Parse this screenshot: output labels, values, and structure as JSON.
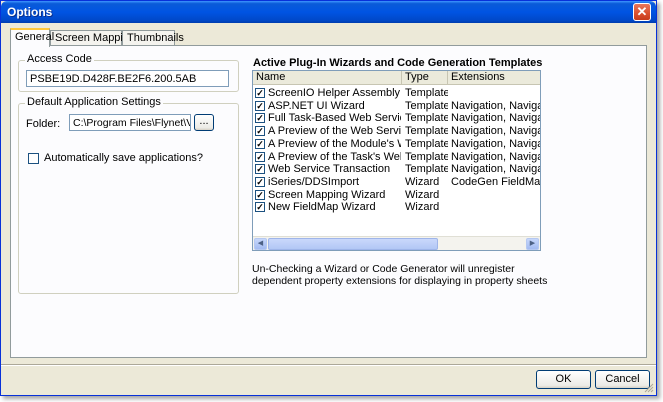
{
  "window": {
    "title": "Options",
    "close_glyph": "✕"
  },
  "tabs": [
    {
      "label": "General"
    },
    {
      "label": "Screen Mapping"
    },
    {
      "label": "Thumbnails"
    }
  ],
  "access_code": {
    "legend": "Access Code",
    "value": "PSBE19D.D428F.BE2F6.200.5AB"
  },
  "app_settings": {
    "legend": "Default Application Settings",
    "folder_label": "Folder:",
    "folder_value": "C:\\Program Files\\Flynet\\Viewer\\",
    "browse_label": "...",
    "autosave_label": "Automatically save applications?"
  },
  "plugins": {
    "title": "Active Plug-In Wizards and Code Generation Templates",
    "columns": [
      "Name",
      "Type",
      "Extensions"
    ],
    "rows": [
      {
        "name": "ScreenIO Helper Assembly",
        "type": "Template",
        "ext": ""
      },
      {
        "name": "ASP.NET UI Wizard",
        "type": "Template",
        "ext": "Navigation, Navigation, Oper"
      },
      {
        "name": "Full Task-Based Web Service",
        "type": "Template",
        "ext": "Navigation, Navigation, Oper"
      },
      {
        "name": "A Preview of the Web Service Prot...",
        "type": "Template",
        "ext": "Navigation, Navigation, Oper"
      },
      {
        "name": "A Preview of the Module's Web Ser...",
        "type": "Template",
        "ext": "Navigation, Navigation, Oper"
      },
      {
        "name": "A Preview of the Task's Web Servi...",
        "type": "Template",
        "ext": "Navigation, Navigation, Oper"
      },
      {
        "name": "Web Service Transaction",
        "type": "Template",
        "ext": "Navigation, Navigation, Oper"
      },
      {
        "name": "iSeries/DDSImport",
        "type": "Wizard",
        "ext": "CodeGen FieldMap Extens"
      },
      {
        "name": "Screen Mapping Wizard",
        "type": "Wizard",
        "ext": ""
      },
      {
        "name": "New FieldMap Wizard",
        "type": "Wizard",
        "ext": ""
      }
    ],
    "check_glyph": "✓",
    "note": "Un-Checking a Wizard or Code Generator will unregister dependent property extensions for displaying in property sheets"
  },
  "buttons": {
    "ok": "OK",
    "cancel": "Cancel"
  },
  "colors": {
    "titlebar": "#0054e3",
    "dialog_bg": "#ece9d8",
    "tab_highlight": "#ffc83c"
  }
}
